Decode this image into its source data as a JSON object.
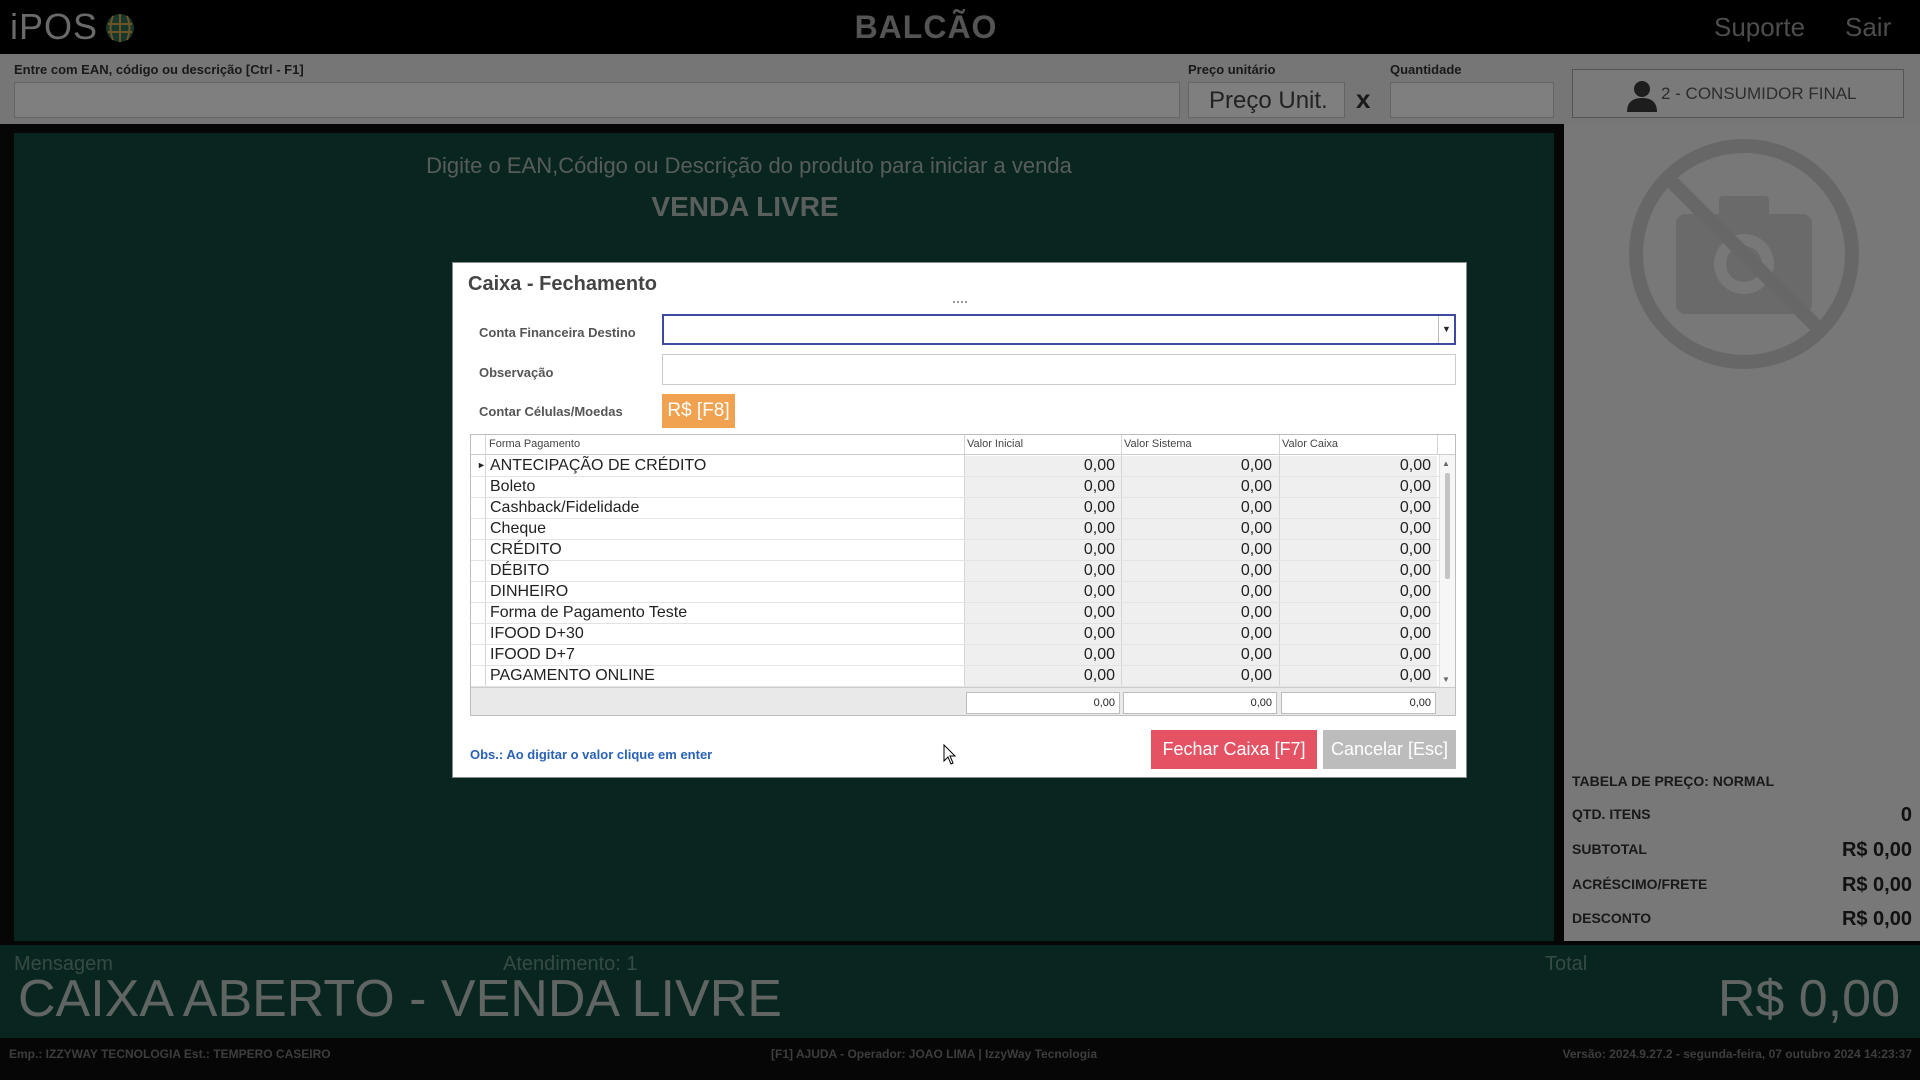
{
  "app": {
    "logo": "iPOS",
    "title": "BALCÃO",
    "support_label": "Suporte",
    "exit_label": "Sair"
  },
  "input_strip": {
    "ean_label": "Entre com EAN, código ou descrição [Ctrl - F1]",
    "price_label": "Preço unitário",
    "price_placeholder": "Preço Unit.",
    "qty_label": "Quantidade",
    "clear_label": "x",
    "customer_label": "2 - CONSUMIDOR FINAL"
  },
  "main": {
    "hint": "Digite o EAN,Código ou Descrição do produto para iniciar a venda",
    "mode": "VENDA LIVRE"
  },
  "right_panel": {
    "rows": [
      {
        "label": "TABELA DE PREÇO: NORMAL",
        "value": ""
      },
      {
        "label": "QTD. ITENS",
        "value": "0"
      },
      {
        "label": "SUBTOTAL",
        "value": "R$ 0,00"
      },
      {
        "label": "ACRÉSCIMO/FRETE",
        "value": "R$ 0,00"
      },
      {
        "label": "DESCONTO",
        "value": "R$ 0,00"
      }
    ]
  },
  "bottom": {
    "message_label": "Mensagem",
    "attendance_label": "Atendimento: 1",
    "total_label": "Total",
    "status": "CAIXA ABERTO - VENDA LIVRE",
    "total_value": "R$ 0,00"
  },
  "footer": {
    "left": "Emp.: IZZYWAY TECNOLOGIA  Est.: TEMPERO CASEIRO",
    "center": "[F1] AJUDA - Operador: JOAO LIMA | IzzyWay Tecnologia",
    "right": "Versão: 2024.9.27.2 - segunda-feira, 07 outubro 2024 14:23:37"
  },
  "modal": {
    "title": "Caixa - Fechamento",
    "account_label": "Conta Financeira Destino",
    "obs_label": "Observação",
    "count_label": "Contar Células/Moedas",
    "count_button": "R$ [F8]",
    "columns": [
      "Forma Pagamento",
      "Valor Inicial",
      "Valor Sistema",
      "Valor Caixa"
    ],
    "rows": [
      {
        "name": "ANTECIPAÇÃO DE CRÉDITO",
        "inicial": "0,00",
        "sistema": "0,00",
        "caixa": "0,00"
      },
      {
        "name": "Boleto",
        "inicial": "0,00",
        "sistema": "0,00",
        "caixa": "0,00"
      },
      {
        "name": "Cashback/Fidelidade",
        "inicial": "0,00",
        "sistema": "0,00",
        "caixa": "0,00"
      },
      {
        "name": "Cheque",
        "inicial": "0,00",
        "sistema": "0,00",
        "caixa": "0,00"
      },
      {
        "name": "CRÉDITO",
        "inicial": "0,00",
        "sistema": "0,00",
        "caixa": "0,00"
      },
      {
        "name": "DÉBITO",
        "inicial": "0,00",
        "sistema": "0,00",
        "caixa": "0,00"
      },
      {
        "name": "DINHEIRO",
        "inicial": "0,00",
        "sistema": "0,00",
        "caixa": "0,00"
      },
      {
        "name": "Forma de Pagamento Teste",
        "inicial": "0,00",
        "sistema": "0,00",
        "caixa": "0,00"
      },
      {
        "name": "IFOOD D+30",
        "inicial": "0,00",
        "sistema": "0,00",
        "caixa": "0,00"
      },
      {
        "name": "IFOOD D+7",
        "inicial": "0,00",
        "sistema": "0,00",
        "caixa": "0,00"
      },
      {
        "name": "PAGAMENTO ONLINE",
        "inicial": "0,00",
        "sistema": "0,00",
        "caixa": "0,00"
      }
    ],
    "totals": {
      "inicial": "0,00",
      "sistema": "0,00",
      "caixa": "0,00"
    },
    "obs_note": "Obs.: Ao digitar o valor clique em enter",
    "close_button": "Fechar Caixa [F7]",
    "cancel_button": "Cancelar [Esc]"
  },
  "icons": {
    "logo_globe": "globe-icon",
    "customer": "person-icon",
    "no_photo": "no-camera-icon",
    "clear": "close-icon"
  },
  "colors": {
    "green": "#114d3e",
    "orange": "#f1a250",
    "red": "#e45263",
    "blue_link": "#2a62b5"
  }
}
